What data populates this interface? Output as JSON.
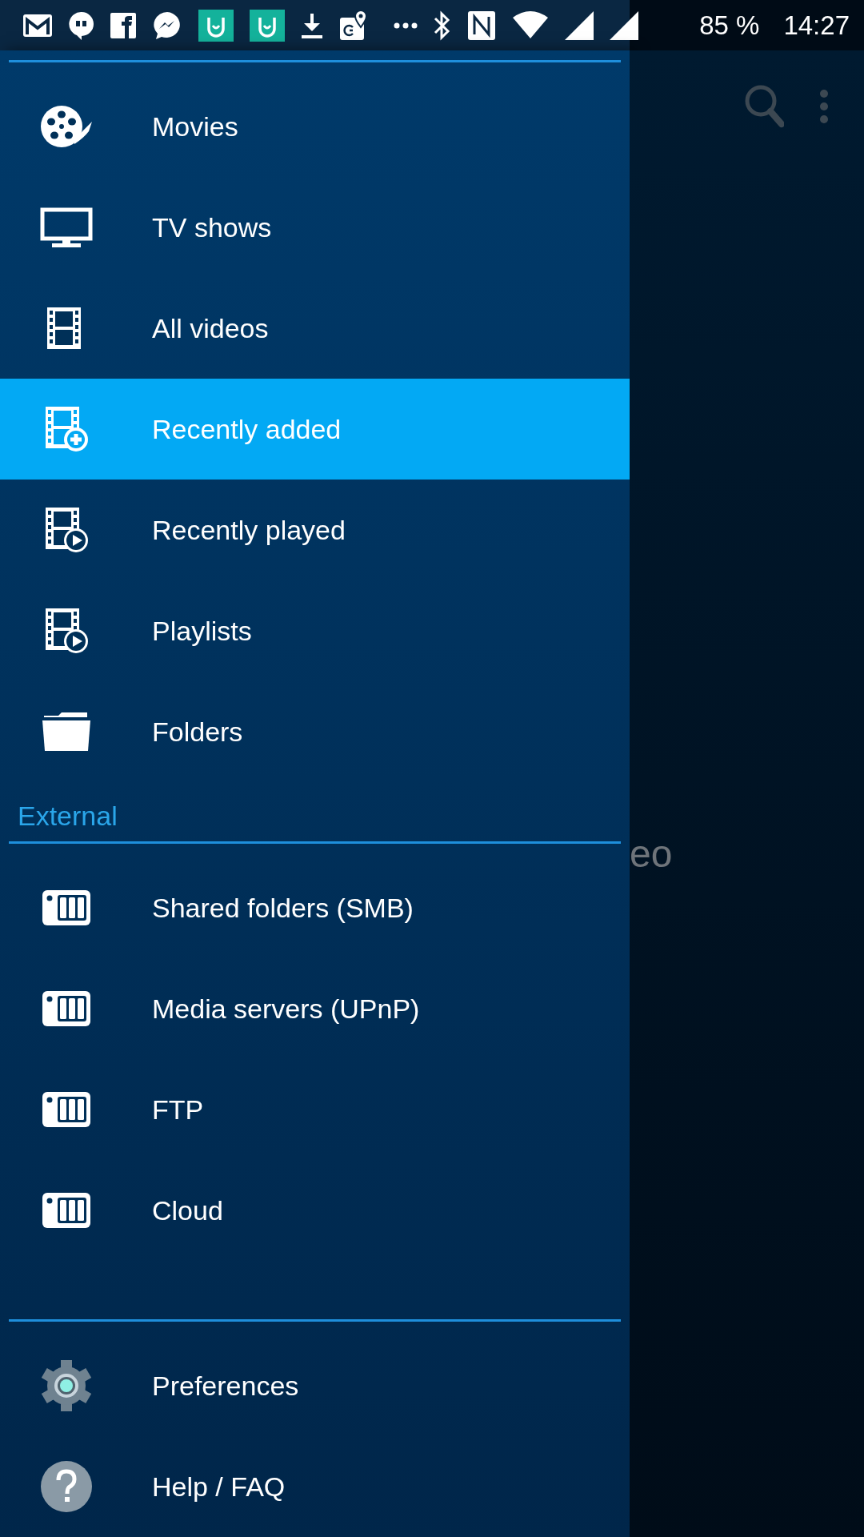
{
  "status_bar": {
    "battery": "85 %",
    "time": "14:27"
  },
  "drawer": {
    "sections": [
      {
        "items": [
          {
            "label": "Movies",
            "kind": "reel",
            "selected": false
          },
          {
            "label": "TV shows",
            "kind": "tv",
            "selected": false
          },
          {
            "label": "All videos",
            "kind": "film",
            "selected": false
          },
          {
            "label": "Recently added",
            "kind": "film-plus",
            "selected": true
          },
          {
            "label": "Recently played",
            "kind": "film-play",
            "selected": false
          },
          {
            "label": "Playlists",
            "kind": "film-play",
            "selected": false
          },
          {
            "label": "Folders",
            "kind": "folder",
            "selected": false
          }
        ]
      },
      {
        "header": "External",
        "items": [
          {
            "label": "Shared folders (SMB)",
            "kind": "server",
            "selected": false
          },
          {
            "label": "Media servers (UPnP)",
            "kind": "server",
            "selected": false
          },
          {
            "label": "FTP",
            "kind": "server",
            "selected": false
          },
          {
            "label": "Cloud",
            "kind": "server",
            "selected": false
          }
        ]
      },
      {
        "items": [
          {
            "label": "Preferences",
            "kind": "gear",
            "selected": false
          },
          {
            "label": "Help / FAQ",
            "kind": "help",
            "selected": false
          }
        ]
      }
    ]
  },
  "background": {
    "text_fragment": "eo"
  }
}
